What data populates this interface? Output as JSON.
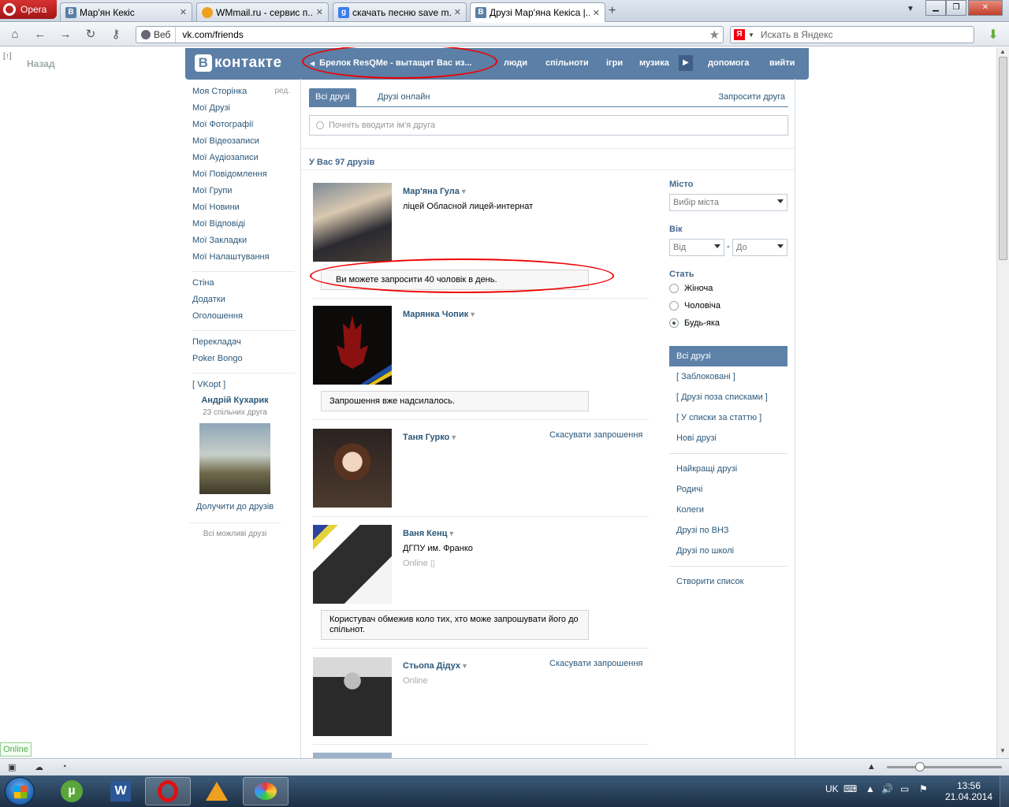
{
  "browser": {
    "menu_label": "Opera",
    "tabs": [
      {
        "label": "Мар'ян Кекіс",
        "favicon": "В",
        "color": "#5b7fa6"
      },
      {
        "label": "WMmail.ru - сервис п...",
        "favicon": "",
        "color": "#f0a020"
      },
      {
        "label": "скачать песню save m...",
        "favicon": "g",
        "color": "#3b7ded"
      },
      {
        "label": "Друзі Мар'яна Кекіса |...",
        "favicon": "В",
        "color": "#5b7fa6"
      }
    ],
    "address": {
      "mode": "Веб",
      "url": "vk.com/friends"
    },
    "search_placeholder": "Искать в Яндекс",
    "search_engine_letter": "Я"
  },
  "page": {
    "back_label": "Назад",
    "back_marker": "[↑]"
  },
  "vk": {
    "logo_letter": "В",
    "logo_text": "контакте",
    "ad_text": "Брелок ResQMe - вытащит Вас из...",
    "nav": [
      "люди",
      "спільноти",
      "ігри",
      "музика",
      "допомога",
      "вийти"
    ],
    "left_menu": {
      "edit_label": "ред.",
      "group1": [
        "Моя Сторінка",
        "Мої Друзі",
        "Мої Фотографії",
        "Мої Відеозаписи",
        "Мої Аудіозаписи",
        "Мої Повідомлення",
        "Мої Групи",
        "Мої Новини",
        "Мої Відповіді",
        "Мої Закладки",
        "Мої Налаштування"
      ],
      "group2": [
        "Стіна",
        "Додатки",
        "Оголошення"
      ],
      "group3": [
        "Перекладач",
        "Poker Bongo"
      ],
      "group4": [
        "[ VKopt ]"
      ]
    },
    "suggestion": {
      "name": "Андрій Кухарик",
      "mutual": "23 спільних друга",
      "add_label": "Долучити до друзів",
      "all_label": "Всі можливі друзі"
    },
    "tabs": {
      "all": "Всі друзі",
      "online": "Друзі онлайн",
      "invite": "Запросити друга"
    },
    "search_placeholder": "Почніть вводити ім'я друга",
    "count_label": "У Вас 97 друзів",
    "friends": [
      {
        "name": "Мар'яна Гула",
        "info": "ліцей Обласной лицей-интернат",
        "notice": "Ви можете запросити 40 чоловік в день."
      },
      {
        "name": "Марянка Чопик",
        "notice": "Запрошення вже надсилалось."
      },
      {
        "name": "Таня Гурко",
        "cancel": "Скасувати запрошення"
      },
      {
        "name": "Ваня Кенц",
        "info": "ДГПУ им. Франко",
        "online": "Online",
        "notice": "Користувач обмежив коло тих, хто може запрошувати його до спільнот."
      },
      {
        "name": "Стьопа Дідух",
        "online": "Online",
        "cancel": "Скасувати запрошення"
      }
    ],
    "filter": {
      "city_label": "Місто",
      "city_value": "Вибір міста",
      "age_label": "Вік",
      "age_from": "Від",
      "age_dash": "-",
      "age_to": "До",
      "sex_label": "Стать",
      "sex_options": [
        "Жіноча",
        "Чоловіча",
        "Будь-яка"
      ],
      "sex_selected": 2
    },
    "lists": {
      "group1": [
        "Всі друзі",
        "[ Заблоковані ]",
        "[ Друзі поза списками ]",
        "[ У списки за статтю ]",
        "Нові друзі"
      ],
      "group2": [
        "Найкращі друзі",
        "Родичі",
        "Колеги",
        "Друзі по ВНЗ",
        "Друзі по школі"
      ],
      "create": "Створити список"
    }
  },
  "status": {
    "online_badge": "Online"
  },
  "taskbar": {
    "lang": "UK",
    "time": "13:56",
    "date": "21.04.2014"
  },
  "colors": {
    "vk_blue": "#5b7fa6",
    "link": "#2b587a",
    "annotation_red": "#ee0000"
  }
}
